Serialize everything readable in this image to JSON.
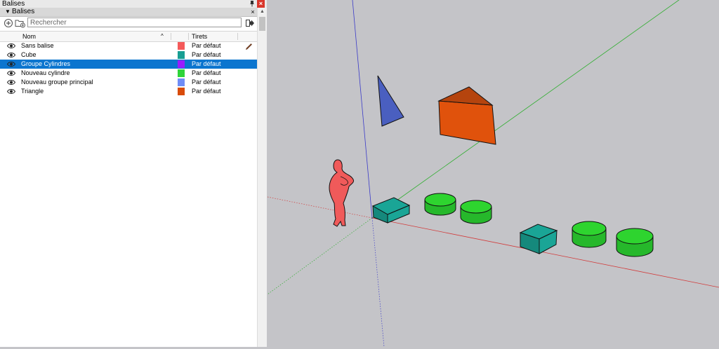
{
  "window": {
    "title": "Balises"
  },
  "section": {
    "label": "Balises",
    "collapse_icon": "triangle-down-icon",
    "close_icon": "close-icon"
  },
  "toolbar": {
    "add_tag_icon": "plus-circle-icon",
    "add_folder_icon": "folder-plus-icon",
    "search_placeholder": "Rechercher",
    "details_icon": "details-arrow-icon"
  },
  "columns": {
    "name": "Nom",
    "dashes": "Tirets"
  },
  "tags": [
    {
      "name": "Sans balise",
      "color": "#f45a5a",
      "dashes": "Par défaut",
      "visible": true,
      "selected": false,
      "active": true
    },
    {
      "name": "Cube",
      "color": "#179e93",
      "dashes": "Par défaut",
      "visible": true,
      "selected": false,
      "active": false
    },
    {
      "name": "Groupe Cylindres",
      "color": "#9a1cff",
      "dashes": "Par défaut",
      "visible": true,
      "selected": true,
      "active": false
    },
    {
      "name": "Nouveau cylindre",
      "color": "#2fd43a",
      "dashes": "Par défaut",
      "visible": true,
      "selected": false,
      "active": false
    },
    {
      "name": "Nouveau groupe principal",
      "color": "#6f8df6",
      "dashes": "Par défaut",
      "visible": true,
      "selected": false,
      "active": false
    },
    {
      "name": "Triangle",
      "color": "#d94c0a",
      "dashes": "Par défaut",
      "visible": true,
      "selected": false,
      "active": false
    }
  ],
  "scene": {
    "objects": [
      "person-figure",
      "blue-triangle",
      "orange-prism",
      "teal-cube",
      "green-cylinder"
    ],
    "colors": {
      "background": "#c4c4c8",
      "person": "#f05a5a",
      "triangle": "#4a5fc0",
      "prism": "#e0520c",
      "cube": "#1aa596",
      "cylinder": "#2ed42f",
      "axis_red": "#d23c3c",
      "axis_green": "#2fae2f",
      "axis_blue": "#3b3bc8"
    }
  }
}
